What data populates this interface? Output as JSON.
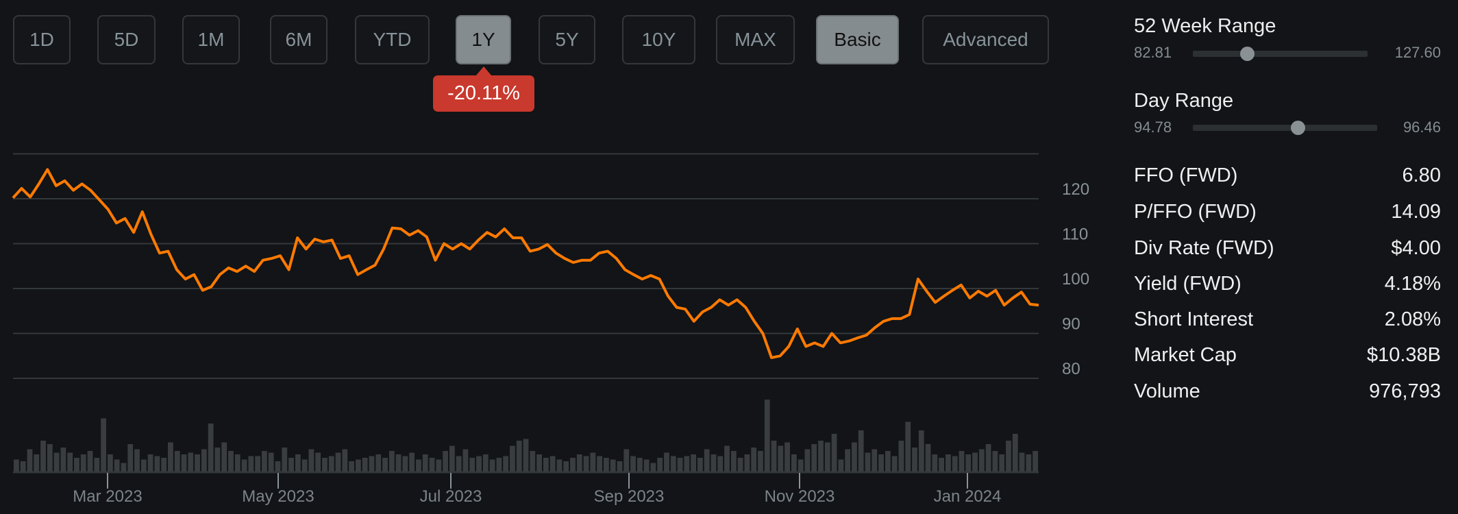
{
  "toolbar": {
    "ranges": [
      "1D",
      "5D",
      "1M",
      "6M",
      "YTD",
      "1Y",
      "5Y",
      "10Y",
      "MAX"
    ],
    "active_range": "1Y",
    "modes": [
      "Basic",
      "Advanced"
    ],
    "active_mode": "Basic",
    "change_badge": "-20.11%"
  },
  "colors": {
    "background": "#121417",
    "line": "#ff7a00",
    "badge": "#c9392d",
    "volume": "#3a3d40",
    "grid": "#34383b"
  },
  "chart_data": {
    "type": "line",
    "title": "",
    "ylabel": "",
    "y_ticks": [
      120,
      110,
      100,
      90,
      80
    ],
    "ylim": [
      75,
      130
    ],
    "x_ticks": [
      "Mar 2023",
      "May 2023",
      "Jul 2023",
      "Sep 2023",
      "Nov 2023",
      "Jan 2024"
    ],
    "x_range": "Feb 2023 - Jan 2024",
    "grid": true,
    "series": [
      {
        "name": "Price",
        "values": [
          120.2,
          122.3,
          120.4,
          123.3,
          126.5,
          122.9,
          124.0,
          121.9,
          123.3,
          121.9,
          119.8,
          117.7,
          114.6,
          115.6,
          112.5,
          117.1,
          112.1,
          107.9,
          108.3,
          104.2,
          102.1,
          103.1,
          99.6,
          100.4,
          103.1,
          104.6,
          103.8,
          105.0,
          103.8,
          106.3,
          106.7,
          107.3,
          104.2,
          111.3,
          108.8,
          111.0,
          110.4,
          110.8,
          106.7,
          107.3,
          103.1,
          104.2,
          105.2,
          108.8,
          113.5,
          113.3,
          111.9,
          112.9,
          111.5,
          106.3,
          110.0,
          108.8,
          110.0,
          108.8,
          110.8,
          112.5,
          111.5,
          113.3,
          111.3,
          111.3,
          108.3,
          108.8,
          109.8,
          107.9,
          106.7,
          105.8,
          106.3,
          106.3,
          107.9,
          108.3,
          106.7,
          104.2,
          103.1,
          102.1,
          102.9,
          102.1,
          98.3,
          95.8,
          95.4,
          92.7,
          94.8,
          95.8,
          97.5,
          96.3,
          97.5,
          95.8,
          92.7,
          90.0,
          84.6,
          85.0,
          87.1,
          91.0,
          87.1,
          87.9,
          87.1,
          90.0,
          87.9,
          88.3,
          89.0,
          89.6,
          91.3,
          92.7,
          93.3,
          93.3,
          94.2,
          102.1,
          99.4,
          96.9,
          98.3,
          99.6,
          100.8,
          97.9,
          99.4,
          98.3,
          99.6,
          96.3,
          97.9,
          99.2,
          96.5,
          96.3
        ]
      },
      {
        "name": "Volume",
        "values": [
          0.7,
          0.6,
          1.3,
          1.0,
          1.8,
          1.6,
          1.1,
          1.4,
          1.1,
          0.8,
          1.0,
          1.2,
          0.8,
          3.1,
          1.0,
          0.7,
          0.5,
          1.6,
          1.3,
          0.7,
          1.0,
          0.9,
          0.8,
          1.7,
          1.2,
          1.0,
          1.1,
          1.0,
          1.3,
          2.8,
          1.4,
          1.7,
          1.2,
          1.0,
          0.7,
          0.9,
          0.9,
          1.2,
          1.1,
          0.6,
          1.4,
          0.8,
          1.0,
          0.7,
          1.3,
          1.1,
          0.8,
          0.9,
          1.1,
          1.3,
          0.6,
          0.7,
          0.8,
          0.9,
          1.0,
          0.8,
          1.2,
          1.0,
          0.9,
          1.1,
          0.7,
          1.0,
          0.8,
          0.7,
          1.2,
          1.5,
          0.9,
          1.3,
          0.8,
          0.9,
          1.0,
          0.7,
          0.8,
          0.9,
          1.5,
          1.8,
          1.9,
          1.2,
          1.0,
          0.8,
          0.9,
          0.7,
          0.6,
          0.8,
          1.0,
          0.9,
          1.1,
          0.9,
          0.8,
          0.7,
          0.6,
          1.3,
          0.9,
          0.8,
          0.7,
          0.5,
          0.8,
          1.1,
          0.9,
          0.8,
          0.9,
          1.0,
          0.8,
          1.3,
          1.0,
          0.9,
          1.5,
          1.2,
          0.8,
          1.0,
          1.4,
          1.2,
          4.2,
          1.8,
          1.5,
          1.7,
          1.0,
          0.7,
          1.3,
          1.6,
          1.8,
          1.7,
          2.2,
          0.7,
          1.3,
          1.7,
          2.4,
          1.1,
          1.3,
          1.0,
          1.2,
          0.9,
          1.8,
          2.9,
          1.4,
          2.4,
          1.6,
          1.0,
          0.8,
          1.0,
          0.9,
          1.2,
          1.0,
          1.1,
          1.3,
          1.6,
          1.2,
          1.0,
          1.8,
          2.2,
          1.1,
          1.0,
          1.2
        ]
      }
    ]
  },
  "side_panel": {
    "week52": {
      "title": "52 Week Range",
      "low": "82.81",
      "high": "127.60",
      "current_fraction": 0.31
    },
    "day": {
      "title": "Day Range",
      "low": "94.78",
      "high": "96.46",
      "current_fraction": 0.57
    },
    "stats": [
      {
        "label": "FFO (FWD)",
        "value": "6.80"
      },
      {
        "label": "P/FFO (FWD)",
        "value": "14.09"
      },
      {
        "label": "Div Rate (FWD)",
        "value": "$4.00"
      },
      {
        "label": "Yield (FWD)",
        "value": "4.18%"
      },
      {
        "label": "Short Interest",
        "value": "2.08%"
      },
      {
        "label": "Market Cap",
        "value": "$10.38B"
      },
      {
        "label": "Volume",
        "value": "976,793"
      }
    ]
  }
}
